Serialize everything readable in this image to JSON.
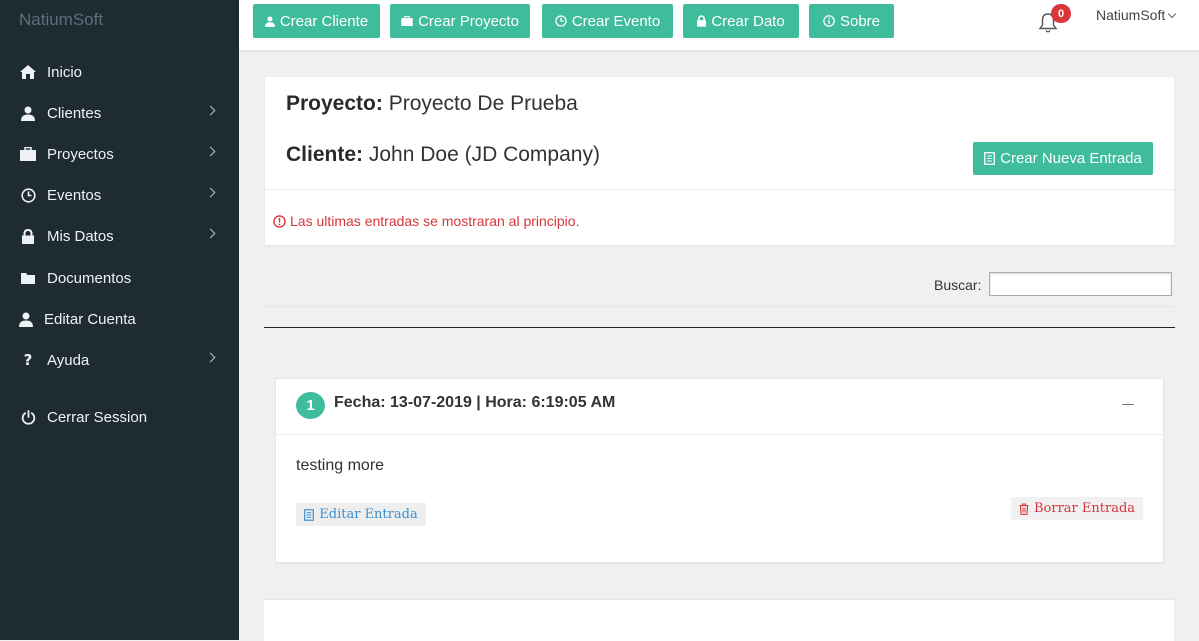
{
  "brand": "NatiumSoft",
  "sidebar": {
    "items": [
      {
        "label": "Inicio",
        "icon": "home-icon",
        "has_submenu": false
      },
      {
        "label": "Clientes",
        "icon": "user-icon",
        "has_submenu": true
      },
      {
        "label": "Proyectos",
        "icon": "briefcase-icon",
        "has_submenu": true
      },
      {
        "label": "Eventos",
        "icon": "clock-icon",
        "has_submenu": true
      },
      {
        "label": "Mis Datos",
        "icon": "lock-icon",
        "has_submenu": true
      },
      {
        "label": "Documentos",
        "icon": "folder-icon",
        "has_submenu": false
      },
      {
        "label": "Editar Cuenta",
        "icon": "user-icon",
        "has_submenu": false
      },
      {
        "label": "Ayuda",
        "icon": "question-icon",
        "has_submenu": true
      },
      {
        "label": "Cerrar Session",
        "icon": "power-icon",
        "has_submenu": false
      }
    ]
  },
  "topbar": {
    "buttons": [
      {
        "label": "Crear Cliente",
        "icon": "user-icon"
      },
      {
        "label": "Crear Proyecto",
        "icon": "briefcase-icon"
      },
      {
        "label": "Crear Evento",
        "icon": "clock-icon"
      },
      {
        "label": "Crear Dato",
        "icon": "lock-icon"
      },
      {
        "label": "Sobre",
        "icon": "info-icon"
      }
    ],
    "notifications": "0",
    "user": "NatiumSoft"
  },
  "project": {
    "project_label": "Proyecto:",
    "project_name": "Proyecto De Prueba",
    "client_label": "Cliente:",
    "client_name": "John Doe (JD Company)",
    "new_entry_label": "Crear Nueva Entrada",
    "notice": "Las ultimas entradas se mostraran al principio."
  },
  "search": {
    "label": "Buscar:",
    "value": ""
  },
  "entries": [
    {
      "number": "1",
      "title": "Fecha: 13-07-2019 | Hora: 6:19:05 AM",
      "text": "testing more",
      "edit_label": "Editar Entrada",
      "delete_label": "Borrar Entrada"
    }
  ],
  "colors": {
    "accent": "#3fbc9c",
    "sidebar_bg": "#1f2b33",
    "danger": "#d6363a",
    "link": "#3a8fd0"
  }
}
